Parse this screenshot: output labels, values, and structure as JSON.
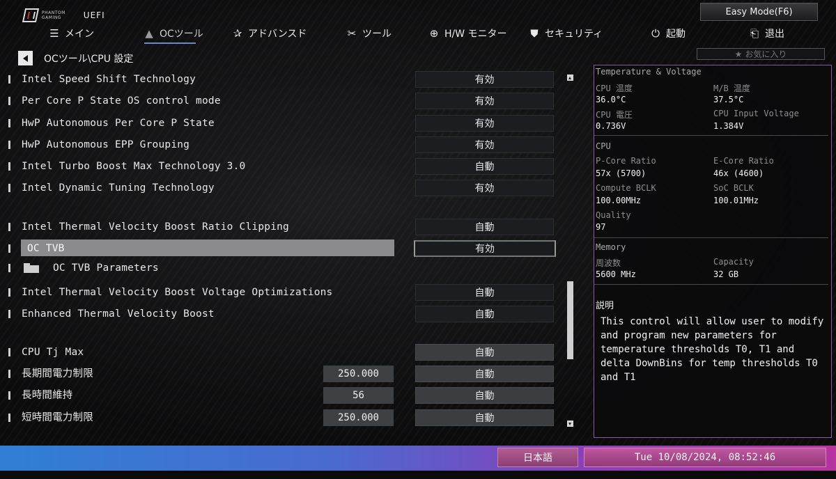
{
  "header": {
    "logo_line1": "PHANTOM",
    "logo_line2": "GAMING",
    "uefi": "UEFI",
    "easy_mode": "Easy Mode(F6)",
    "favorites": "お気に入り"
  },
  "nav": [
    {
      "icon": "list-icon",
      "glyph": "☰",
      "label": "メイン"
    },
    {
      "icon": "rocket-icon",
      "glyph": "🚀",
      "label": "OCツール",
      "active": true
    },
    {
      "icon": "star-icon",
      "glyph": "✰",
      "label": "アドバンスド"
    },
    {
      "icon": "tools-icon",
      "glyph": "✂",
      "label": "ツール"
    },
    {
      "icon": "monitor-icon",
      "glyph": "⊕",
      "label": "H/W モニター"
    },
    {
      "icon": "shield-icon",
      "glyph": "⛊",
      "label": "セキュリティ"
    },
    {
      "icon": "power-icon",
      "glyph": "⏻",
      "label": "起動"
    },
    {
      "icon": "exit-icon",
      "glyph": "⎗",
      "label": "退出"
    }
  ],
  "breadcrumb": "OCツール\\CPU 設定",
  "settings": [
    {
      "label": "Intel Speed Shift Technology",
      "value": "有効"
    },
    {
      "label": "Per Core P State OS control mode",
      "value": "有効"
    },
    {
      "label": "HwP Autonomous Per Core P State",
      "value": "有効"
    },
    {
      "label": "HwP Autonomous EPP Grouping",
      "value": "有効"
    },
    {
      "label": "Intel Turbo Boost Max Technology 3.0",
      "value": "自動"
    },
    {
      "label": "Intel Dynamic Tuning Technology",
      "value": "有効"
    },
    {
      "label": "Intel Thermal Velocity Boost Ratio Clipping",
      "value": "自動"
    },
    {
      "label": "OC TVB",
      "value": "有効",
      "selected": true
    },
    {
      "label": "OC TVB Parameters"
    },
    {
      "label": "Intel Thermal Velocity Boost Voltage Optimizations",
      "value": "自動"
    },
    {
      "label": "Enhanced Thermal Velocity Boost",
      "value": "自動"
    },
    {
      "label": "CPU Tj Max",
      "value": "自動"
    },
    {
      "label": "長期間電力制限",
      "number": "250.000",
      "value": "自動"
    },
    {
      "label": "長時間維持",
      "number": "56",
      "value": "自動"
    },
    {
      "label": "短時間電力制限",
      "number": "250.000",
      "value": "自動"
    }
  ],
  "panel": {
    "tv_title": "Temperature & Voltage",
    "cpu_temp_k": "CPU 温度",
    "cpu_temp_v": "36.0°C",
    "mb_temp_k": "M/B 温度",
    "mb_temp_v": "37.5°C",
    "cpu_volt_k": "CPU 電圧",
    "cpu_volt_v": "0.736V",
    "cpu_in_k": "CPU Input Voltage",
    "cpu_in_v": "1.384V",
    "cpu_title": "CPU",
    "pcore_k": "P-Core Ratio",
    "pcore_v": "57x (5700)",
    "ecore_k": "E-Core Ratio",
    "ecore_v": "46x (4600)",
    "cbclk_k": "Compute BCLK",
    "cbclk_v": "100.00MHz",
    "sbclk_k": "SoC BCLK",
    "sbclk_v": "100.01MHz",
    "quality_k": "Quality",
    "quality_v": "97",
    "mem_title": "Memory",
    "freq_k": "周波数",
    "freq_v": "5600 MHz",
    "cap_k": "Capacity",
    "cap_v": "32 GB",
    "desc_title": "説明",
    "desc": "This control will allow user to modify and program new parameters for temperature thresholds T0, T1 and delta DownBins for temp thresholds T0 and T1"
  },
  "footer": {
    "language": "日本語",
    "datetime": "Tue 10/08/2024, 08:52:46"
  }
}
